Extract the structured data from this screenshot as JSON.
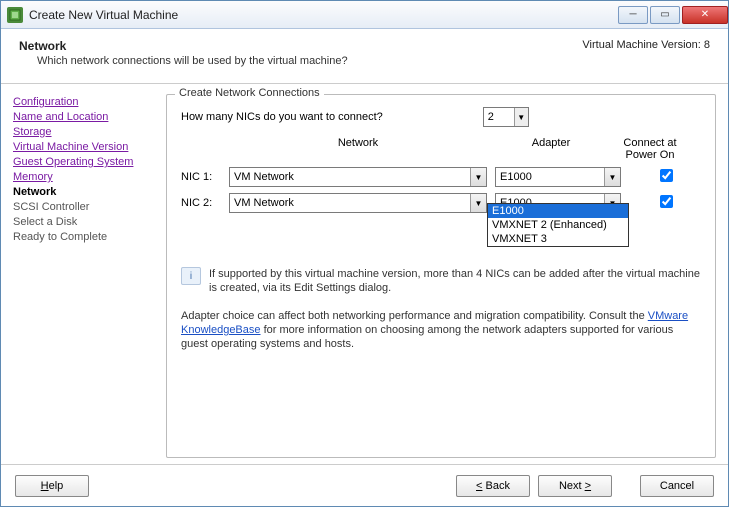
{
  "window": {
    "title": "Create New Virtual Machine"
  },
  "header": {
    "title": "Network",
    "subtitle": "Which network connections will be used by the virtual machine?",
    "version_label": "Virtual Machine Version: 8"
  },
  "sidebar": {
    "items": [
      {
        "label": "Configuration",
        "state": "done"
      },
      {
        "label": "Name and Location",
        "state": "done"
      },
      {
        "label": "Storage",
        "state": "done"
      },
      {
        "label": "Virtual Machine Version",
        "state": "done"
      },
      {
        "label": "Guest Operating System",
        "state": "done"
      },
      {
        "label": "Memory",
        "state": "done"
      },
      {
        "label": "Network",
        "state": "current"
      },
      {
        "label": "SCSI Controller",
        "state": "upcoming"
      },
      {
        "label": "Select a Disk",
        "state": "upcoming"
      },
      {
        "label": "Ready to Complete",
        "state": "upcoming"
      }
    ]
  },
  "panel": {
    "legend": "Create Network Connections",
    "question": "How many NICs do you want to connect?",
    "nic_count": "2",
    "columns": {
      "network": "Network",
      "adapter": "Adapter",
      "connect": "Connect at Power On"
    },
    "nics": [
      {
        "label": "NIC 1:",
        "network": "VM Network",
        "adapter": "E1000",
        "connect": true
      },
      {
        "label": "NIC 2:",
        "network": "VM Network",
        "adapter": "E1000",
        "connect": true
      }
    ],
    "adapter_options": [
      "E1000",
      "VMXNET 2 (Enhanced)",
      "VMXNET 3"
    ],
    "info_text": "If supported by this virtual machine version, more than 4 NICs can be added after the virtual machine is created, via its Edit Settings dialog.",
    "adapter_note_1": "Adapter choice can affect both networking performance and migration compatibility. Consult the ",
    "kb_link": "VMware KnowledgeBase",
    "adapter_note_2": " for more information on choosing among the network adapters supported for various guest operating systems and hosts."
  },
  "footer": {
    "help": "Help",
    "back": "Back",
    "next": "Next",
    "cancel": "Cancel"
  }
}
